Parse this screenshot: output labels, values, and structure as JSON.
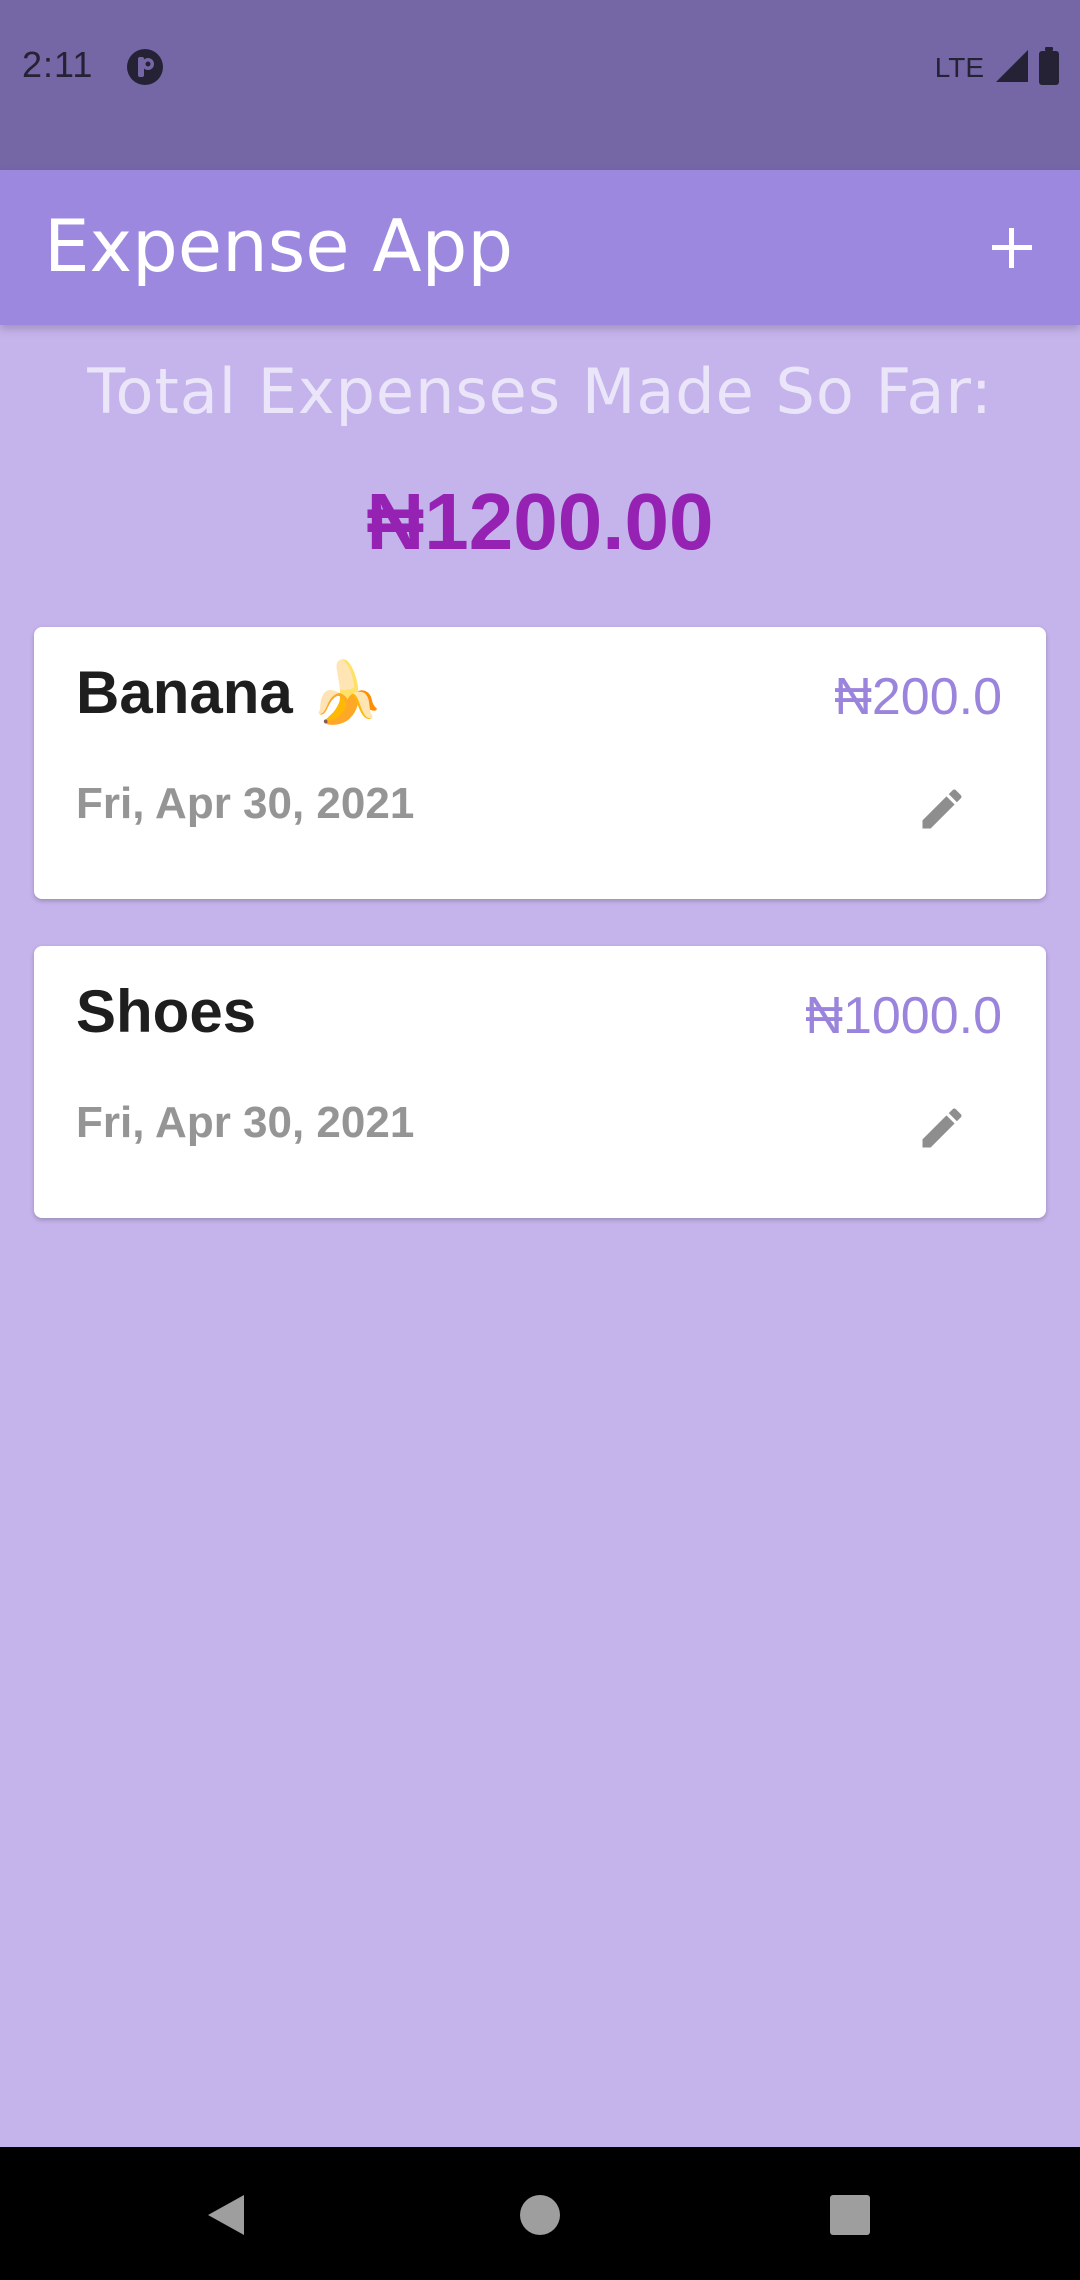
{
  "status_bar": {
    "time": "2:11",
    "network": "LTE",
    "icons": [
      "app-notification-icon",
      "lte-signal-icon",
      "battery-icon"
    ]
  },
  "app_bar": {
    "title": "Expense App",
    "add_icon": "plus-icon"
  },
  "summary": {
    "label": "Total Expenses Made So Far:",
    "total": "₦1200.00"
  },
  "expenses": [
    {
      "title": "Banana 🍌",
      "amount": "₦200.0",
      "date": "Fri, Apr 30, 2021",
      "edit_icon": "pencil-icon"
    },
    {
      "title": "Shoes",
      "amount": "₦1000.0",
      "date": "Fri, Apr 30, 2021",
      "edit_icon": "pencil-icon"
    }
  ],
  "nav_bar": {
    "icons": [
      "back-icon",
      "home-icon",
      "recents-icon"
    ]
  },
  "colors": {
    "status_bar": "#7567a6",
    "app_bar": "#9d88e0",
    "background": "#c5b3eb",
    "total_amount": "#9522b2",
    "expense_amount": "#9a84dc",
    "date_text": "#959595"
  }
}
